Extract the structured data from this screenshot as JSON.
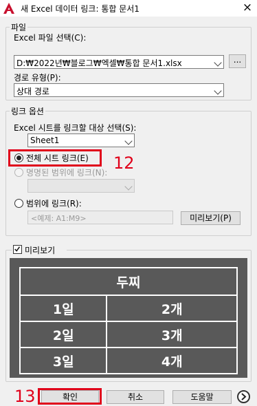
{
  "window": {
    "title": "새 Excel 데이터 링크: 통합 문서1",
    "close": "×"
  },
  "file_group": {
    "label": "파일",
    "select_label": "Excel 파일 선택(C):",
    "path": "D:₩2022년₩블로그₩엑셀₩통합 문서1.xlsx",
    "browse_label": "...",
    "path_type_label": "경로 유형(P):",
    "path_type_value": "상대 경로"
  },
  "link_group": {
    "label": "링크 옵션",
    "sheet_select_label": "Excel 시트를 링크할 대상 선택(S):",
    "sheet_value": "Sheet1",
    "radio_full_sheet": "전체 시트 링크(E)",
    "radio_named_range": "명명된 범위에 링크(N):",
    "named_range_value": "",
    "radio_range": "범위에 링크(R):",
    "range_placeholder": "<예제: A1:M9>",
    "preview_button": "미리보기(P)"
  },
  "preview_group": {
    "label": "미리보기",
    "checked": true,
    "table": {
      "header": "두찌",
      "rows": [
        [
          "1일",
          "2개"
        ],
        [
          "2일",
          "3개"
        ],
        [
          "3일",
          "4개"
        ]
      ]
    }
  },
  "buttons": {
    "ok": "확인",
    "cancel": "취소",
    "help": "도움말"
  },
  "annotations": {
    "step12": "12",
    "step13": "13"
  },
  "colors": {
    "annotation": "#e0001a",
    "preview_bg": "#595959",
    "autocad_red": "#c8102e"
  }
}
